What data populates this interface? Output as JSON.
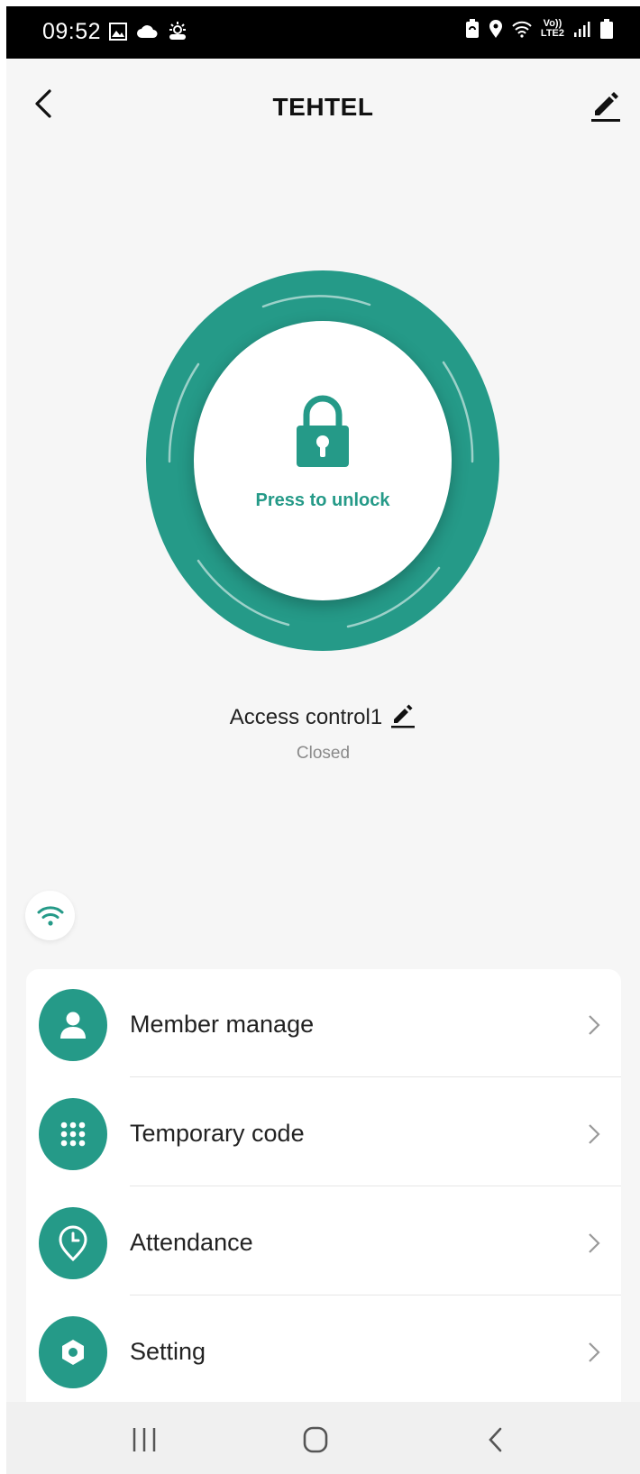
{
  "status_bar": {
    "time": "09:52",
    "left_icons": [
      "image-icon",
      "cloud-icon",
      "sun-cloud-icon"
    ],
    "right_icons": [
      "battery-saver-icon",
      "location-icon",
      "wifi-icon",
      "signal-icon",
      "battery-icon"
    ],
    "network_top": "Vo))",
    "network_bottom": "LTE2"
  },
  "header": {
    "title": "TEHTEL"
  },
  "unlock": {
    "label": "Press to unlock"
  },
  "device": {
    "name": "Access control1",
    "status": "Closed"
  },
  "menu": {
    "items": [
      {
        "label": "Member manage",
        "icon": "person-icon"
      },
      {
        "label": "Temporary code",
        "icon": "keypad-icon"
      },
      {
        "label": "Attendance",
        "icon": "clock-pin-icon"
      },
      {
        "label": "Setting",
        "icon": "gear-icon"
      }
    ]
  },
  "colors": {
    "accent": "#259a88",
    "background": "#f6f6f6",
    "status_text": "#8a8a8a"
  }
}
